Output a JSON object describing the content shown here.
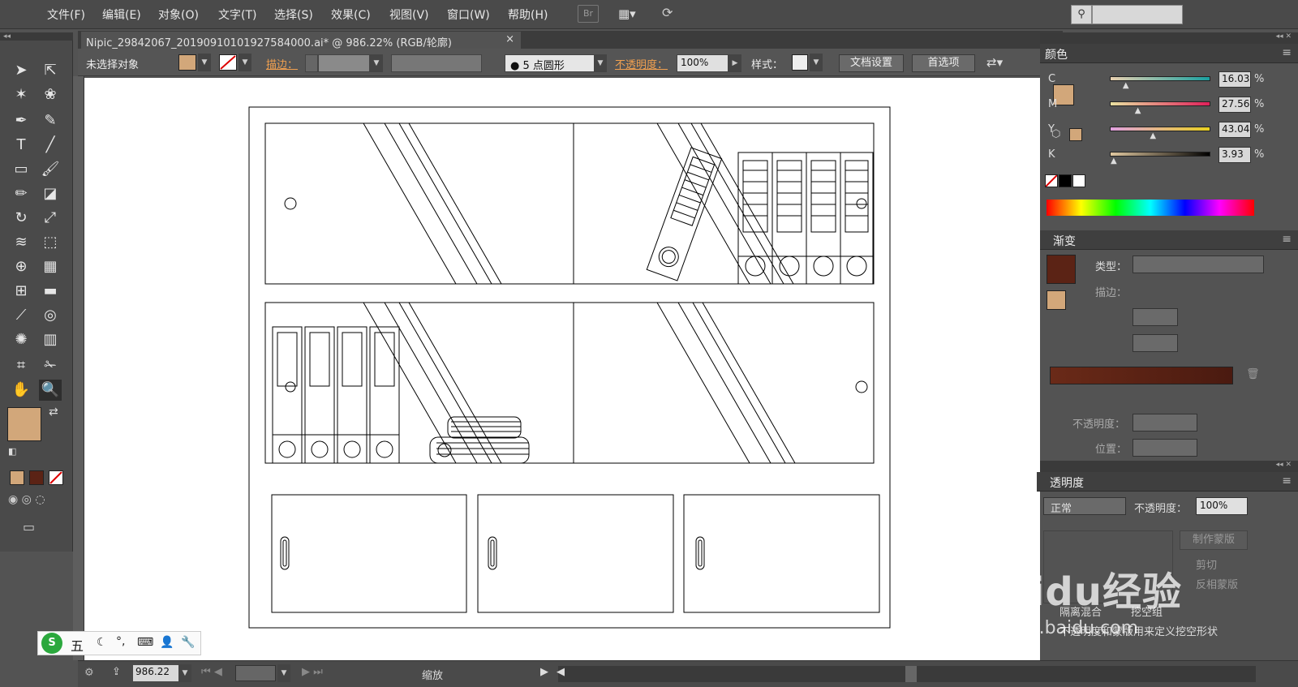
{
  "menu": [
    "文件(F)",
    "编辑(E)",
    "对象(O)",
    "文字(T)",
    "选择(S)",
    "效果(C)",
    "视图(V)",
    "窗口(W)",
    "帮助(H)"
  ],
  "bridge_label": "Br",
  "document_tab": {
    "title": "Nipic_29842067_20190910101927584000.ai* @ 986.22% (RGB/轮廓)",
    "close": "×"
  },
  "control": {
    "selection": "未选择对象",
    "stroke_label": "描边：",
    "brush": "5 点圆形",
    "opacity_label": "不透明度：",
    "opacity_value": "100%",
    "style_label": "样式：",
    "doc_setup": "文档设置",
    "preferences": "首选项"
  },
  "colors": {
    "fill": "#d2a77a",
    "accent_orange": "#f0a050",
    "gradient_dark": "#5b2315",
    "canvas": "#ffffff"
  },
  "color_panel": {
    "title": "颜色",
    "channels": [
      {
        "name": "C",
        "value": "16.03",
        "pct": "%",
        "level": 0.16
      },
      {
        "name": "M",
        "value": "27.56",
        "pct": "%",
        "level": 0.28
      },
      {
        "name": "Y",
        "value": "43.04",
        "pct": "%",
        "level": 0.43
      },
      {
        "name": "K",
        "value": "3.93",
        "pct": "%",
        "level": 0.04
      }
    ]
  },
  "gradient_panel": {
    "title": "渐变",
    "type_label": "类型：",
    "stroke_label": "描边：",
    "opacity_label": "不透明度：",
    "position_label": "位置："
  },
  "transparency_panel": {
    "title": "透明度",
    "mode": "正常",
    "opacity_label": "不透明度：",
    "opacity_value": "100%",
    "make_mask": "制作蒙版",
    "clip": "剪切",
    "invert": "反相蒙版",
    "isolate": "隔离混合",
    "knockout": "挖空组",
    "opacity_knockout": "不透明度和蒙版用来定义挖空形状"
  },
  "status": {
    "zoom": "986.22",
    "mode": "缩放"
  },
  "ime": {
    "input_mode": "五"
  },
  "watermark": {
    "brand": "Baidu经验",
    "url": "jingyan.baidu.com"
  }
}
